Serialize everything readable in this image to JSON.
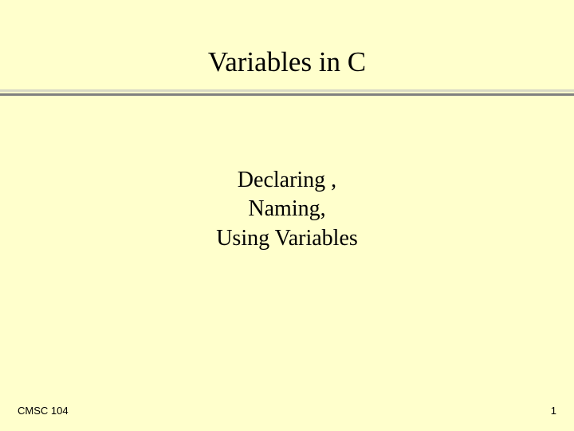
{
  "title": "Variables in C",
  "subtitle": {
    "line1": "Declaring ,",
    "line2": "Naming,",
    "line3": "Using Variables"
  },
  "footer": {
    "course": "CMSC 104",
    "page": "1"
  }
}
